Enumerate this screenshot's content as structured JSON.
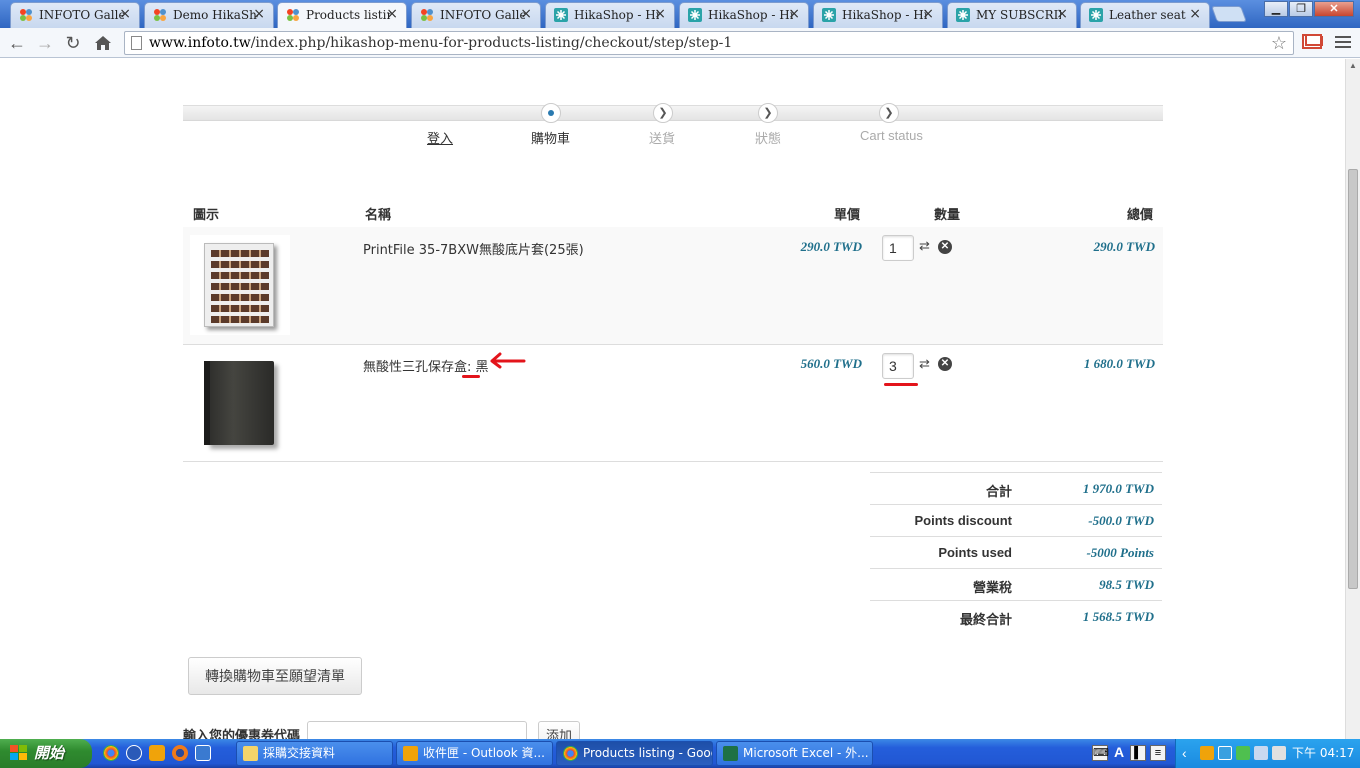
{
  "browser": {
    "tabs": [
      {
        "title": "INFOTO Gallery",
        "favicon": "joomla-icon"
      },
      {
        "title": "Demo HikaShop",
        "favicon": "joomla-icon"
      },
      {
        "title": "Products listing",
        "favicon": "joomla-icon",
        "active": true
      },
      {
        "title": "INFOTO Gallery",
        "favicon": "joomla-icon"
      },
      {
        "title": "HikaShop - Hika",
        "favicon": "hikashop-icon"
      },
      {
        "title": "HikaShop - Hika",
        "favicon": "hikashop-icon"
      },
      {
        "title": "HikaShop - Hika",
        "favicon": "hikashop-icon"
      },
      {
        "title": "MY SUBSCRIPT",
        "favicon": "hikashop-icon"
      },
      {
        "title": "Leather seat",
        "favicon": "hikashop-icon"
      }
    ],
    "tab_close": "×",
    "url_domain": "www.infoto.tw",
    "url_path": "/index.php/hikashop-menu-for-products-listing/checkout/step/step-1"
  },
  "checkout": {
    "steps": [
      {
        "label": "登入",
        "state": "done"
      },
      {
        "label": "購物車",
        "state": "current"
      },
      {
        "label": "送貨",
        "state": "future"
      },
      {
        "label": "狀態",
        "state": "future"
      },
      {
        "label": "Cart status",
        "state": "future"
      }
    ]
  },
  "cart": {
    "headers": {
      "image": "圖示",
      "name": "名稱",
      "unit_price": "單價",
      "quantity": "數量",
      "total": "總價"
    },
    "items": [
      {
        "name": "PrintFile 35-7BXW無酸底片套(25張)",
        "unit_price": "290.0 TWD",
        "quantity": "1",
        "total": "290.0 TWD"
      },
      {
        "name": "無酸性三孔保存盒: 黑",
        "unit_price": "560.0 TWD",
        "quantity": "3",
        "total": "1 680.0 TWD"
      }
    ],
    "totals": [
      {
        "label": "合計",
        "value": "1 970.0 TWD"
      },
      {
        "label": "Points discount",
        "value": "-500.0 TWD"
      },
      {
        "label": "Points used",
        "value": "-5000 Points"
      },
      {
        "label": "營業稅",
        "value": "98.5 TWD"
      },
      {
        "label": "最終合計",
        "value": "1 568.5 TWD"
      }
    ],
    "wishlist_button": "轉換購物車至願望清單",
    "coupon_label": "輸入您的優惠券代碼",
    "coupon_button": "添加"
  },
  "taskbar": {
    "start_label": "開始",
    "items": [
      {
        "label": "採購交接資料",
        "icon": "folder-icon"
      },
      {
        "label": "收件匣 - Outlook 資...",
        "icon": "outlook-icon"
      },
      {
        "label": "Products listing - Goog...",
        "icon": "chrome-icon",
        "active": true
      },
      {
        "label": "Microsoft Excel - 外...",
        "icon": "excel-icon"
      }
    ],
    "lang": "A",
    "clock": "下午 04:17"
  },
  "colors": {
    "accent": "#1f6f8b",
    "annotation": "#e3141b"
  }
}
